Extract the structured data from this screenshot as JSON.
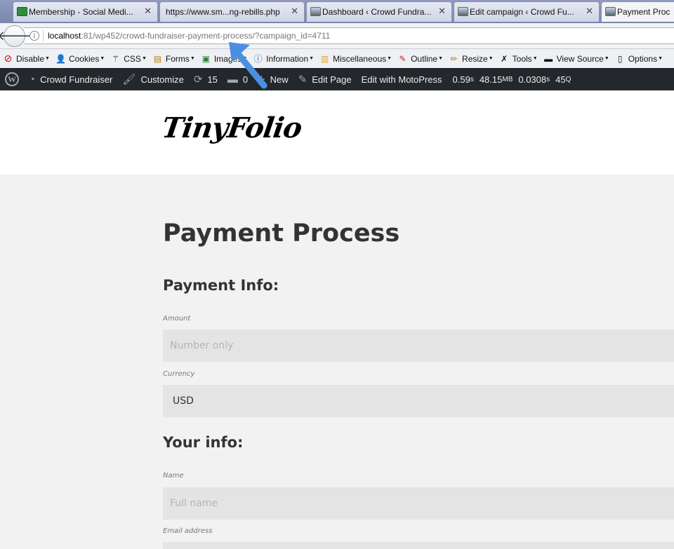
{
  "tabs": [
    {
      "title": "Membership - Social Medi...",
      "favicon": "social-media-club-favicon"
    },
    {
      "title": "https://www.sm...ng-rebills.php",
      "favicon": ""
    },
    {
      "title": "Dashboard ‹ Crowd Fundra...",
      "favicon": "landscape-favicon"
    },
    {
      "title": "Edit campaign ‹ Crowd Fu...",
      "favicon": "landscape-favicon"
    },
    {
      "title": "Payment Proc",
      "favicon": "landscape-favicon"
    }
  ],
  "address": {
    "host": "localhost",
    "rest": ":81/wp452/crowd-fundraiser-payment-process/?campaign_id=4711"
  },
  "devtoolbar": [
    {
      "label": "Disable",
      "icon": "disable-icon"
    },
    {
      "label": "Cookies",
      "icon": "cookies-icon"
    },
    {
      "label": "CSS",
      "icon": "css-wand-icon"
    },
    {
      "label": "Forms",
      "icon": "forms-icon"
    },
    {
      "label": "Images",
      "icon": "images-icon"
    },
    {
      "label": "Information",
      "icon": "information-icon"
    },
    {
      "label": "Miscellaneous",
      "icon": "miscellaneous-icon"
    },
    {
      "label": "Outline",
      "icon": "outline-pencil-icon"
    },
    {
      "label": "Resize",
      "icon": "resize-icon"
    },
    {
      "label": "Tools",
      "icon": "tools-icon"
    },
    {
      "label": "View Source",
      "icon": "view-source-icon"
    },
    {
      "label": "Options",
      "icon": "options-icon"
    }
  ],
  "adminbar": {
    "site_name": "Crowd Fundraiser",
    "customize": "Customize",
    "updates": "15",
    "comments": "0",
    "new": "New",
    "edit_page": "Edit Page",
    "motopress": "Edit with MotoPress",
    "time": "0.59",
    "time_unit": "s",
    "memory": "48.15",
    "memory_unit": "MB",
    "query_time": "0.0308",
    "query_time_unit": "s",
    "queries": "45",
    "queries_unit": "Q"
  },
  "site": {
    "logo": "TinyFolio"
  },
  "page": {
    "title": "Payment Process",
    "payment_section": "Payment Info:",
    "amount_label": "Amount",
    "amount_placeholder": "Number only",
    "currency_label": "Currency",
    "currency_value": "USD",
    "your_info_section": "Your info:",
    "name_label": "Name",
    "name_placeholder": "Full name",
    "email_label": "Email address"
  },
  "colors": {
    "adminbar_bg": "#23282d",
    "annotation_arrow": "#4a90e2"
  }
}
